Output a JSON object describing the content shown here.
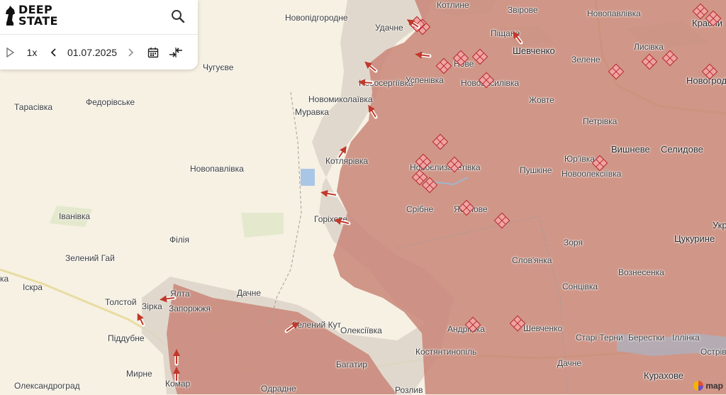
{
  "app": {
    "logo_line1": "DEEP",
    "logo_line2": "STATE"
  },
  "controls": {
    "speed": "1x",
    "date": "01.07.2025"
  },
  "attribution": {
    "text": "map"
  },
  "colors": {
    "occupied": "#c98678",
    "contested": "#ddd3c9",
    "marker": "#f1a3a3",
    "marker_border": "#b22a2a",
    "base": "#f6f1e3"
  },
  "labels": {
    "novopidhorodne": "Новопідгородне",
    "udachne": "Удачне",
    "kotlyne": "Котлине",
    "zvirove": "Звірове",
    "novopavlivka_top": "Новопавлівка",
    "krasnyi": "Красни",
    "pishchane": "Піщане",
    "shevchenko_top": "Шевченко",
    "zelene": "Зелене",
    "lysivka": "Лисівка",
    "novohrodivka": "Новогрод",
    "chuhuieve": "Чугуєве",
    "novoserhiivka": "Новосергіївка",
    "uspenivka": "Успенівка",
    "novovasylivka": "Нововасилівка",
    "novoe": "Нове",
    "zhovte": "Жовте",
    "tarasivka": "Тарасівка",
    "fedorivske": "Федорівське",
    "novomykolaivka": "Новомиколаївка",
    "muravka": "Муравка",
    "petrivka": "Петрівка",
    "vyshneve": "Вишневе",
    "selydove": "Селидове",
    "yurivka": "Юр'ївка",
    "novooleksiivka": "Новоолексіївка",
    "kotliarivka": "Котлярівка",
    "novoielyzavetivka": "Новоєлизаветівка",
    "pushkine": "Пушкіне",
    "novopavlivka_mid": "Новопавлівка",
    "ivanivka": "Іванівка",
    "horikhove": "Горіхове",
    "sribne": "Срібне",
    "yasenove": "Ясенове",
    "ukr": "Укр",
    "tsukuryne": "Цукурине",
    "filiia": "Філія",
    "zoria": "Зоря",
    "zelenyi_hai": "Зелений Гай",
    "slovianka": "Слов'янка",
    "voznesenka": "Вознесенка",
    "iskra": "Іскра",
    "tolstoi": "Толстой",
    "yalta": "Ялта",
    "dachne_top": "Дачне",
    "sonstivka": "Сонцівка",
    "zirka": "Зірка",
    "zaporizhzhia": "Запоріжжя",
    "zelenyi_kut": "Зелений Кут",
    "oleksiivka": "Олексіївка",
    "andriivka": "Андріївка",
    "shevchenko_bot": "Шевченко",
    "stari_terny": "Старі Терни",
    "berestky": "Берестки",
    "illinka": "Іллінка",
    "pidduben": "Піддубне",
    "kostiantynopil": "Костянтинопіль",
    "ostriv": "Острів",
    "myrne": "Мирне",
    "bahatyr": "Багатир",
    "dachne_bot": "Дачне",
    "kurakhove": "Курахове",
    "oleksandrohrad": "Олександроград",
    "komar": "Комар",
    "odradne": "Одрадне",
    "rozliv": "Розлив",
    "ka": "ка"
  }
}
